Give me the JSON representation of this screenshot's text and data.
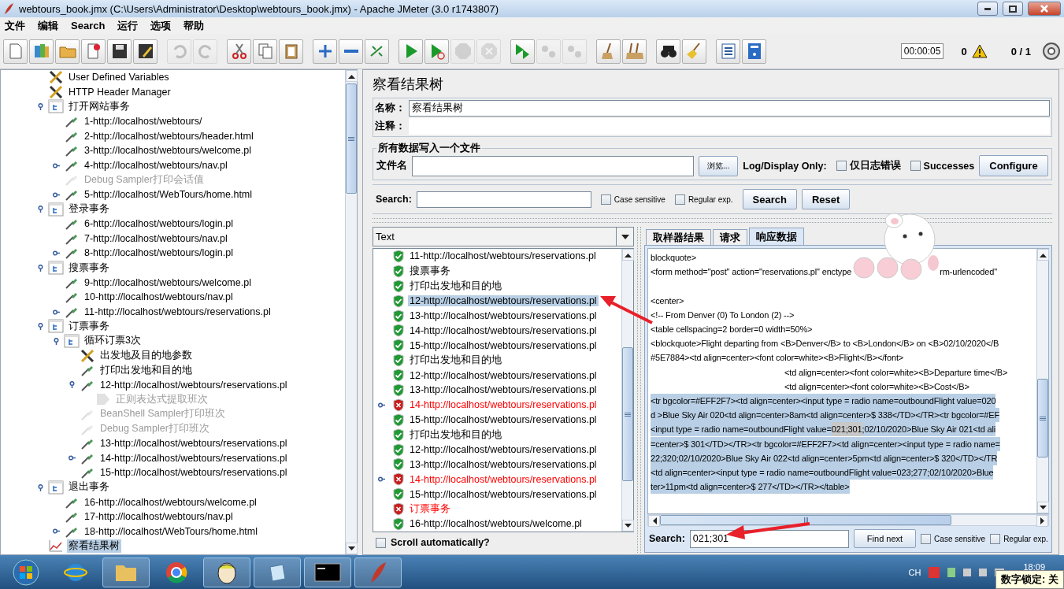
{
  "window": {
    "title": "webtours_book.jmx (C:\\Users\\Administrator\\Desktop\\webtours_book.jmx) - Apache JMeter (3.0 r1743807)"
  },
  "menu": [
    "文件",
    "编辑",
    "Search",
    "运行",
    "选项",
    "帮助"
  ],
  "toolbar": [
    {
      "kind": "new",
      "disabled": false
    },
    {
      "kind": "templates",
      "disabled": false
    },
    {
      "kind": "open",
      "disabled": false
    },
    {
      "kind": "close",
      "disabled": false
    },
    {
      "kind": "save",
      "disabled": false
    },
    {
      "kind": "save_as",
      "disabled": false
    },
    {
      "kind": "sep"
    },
    {
      "kind": "undo",
      "disabled": true
    },
    {
      "kind": "redo",
      "disabled": true
    },
    {
      "kind": "sep"
    },
    {
      "kind": "cut",
      "disabled": false
    },
    {
      "kind": "copy",
      "disabled": false
    },
    {
      "kind": "paste",
      "disabled": false
    },
    {
      "kind": "sep"
    },
    {
      "kind": "expand",
      "disabled": false
    },
    {
      "kind": "collapse",
      "disabled": false
    },
    {
      "kind": "toggle",
      "disabled": false
    },
    {
      "kind": "sep"
    },
    {
      "kind": "start",
      "disabled": false
    },
    {
      "kind": "start_no_pause",
      "disabled": false
    },
    {
      "kind": "stop",
      "disabled": true
    },
    {
      "kind": "shutdown",
      "disabled": true
    },
    {
      "kind": "sep"
    },
    {
      "kind": "remote_start",
      "disabled": false
    },
    {
      "kind": "remote_stop",
      "disabled": true
    },
    {
      "kind": "remote_exit",
      "disabled": true
    },
    {
      "kind": "sep"
    },
    {
      "kind": "clear",
      "disabled": false
    },
    {
      "kind": "clear_all",
      "disabled": false
    },
    {
      "kind": "sep"
    },
    {
      "kind": "search",
      "disabled": false
    },
    {
      "kind": "reset_search",
      "disabled": false
    },
    {
      "kind": "sep"
    },
    {
      "kind": "functions",
      "disabled": false
    },
    {
      "kind": "help",
      "disabled": false
    }
  ],
  "status": {
    "timer": "00:00:05",
    "warnings": "0",
    "threads": "0 / 1"
  },
  "tree": [
    {
      "kind": "config",
      "label": "User Defined Variables",
      "handle": false,
      "disabled": false,
      "selected": false
    },
    {
      "kind": "config",
      "label": "HTTP Header Manager",
      "handle": false,
      "disabled": false,
      "selected": false
    },
    {
      "kind": "controller",
      "label": "打开网站事务",
      "handle": true,
      "expanded": true,
      "disabled": false,
      "selected": false,
      "children": [
        {
          "kind": "sampler",
          "label": "1-http://localhost/webtours/",
          "handle": false,
          "disabled": false,
          "selected": false
        },
        {
          "kind": "sampler",
          "label": "2-http://localhost/webtours/header.html",
          "handle": false,
          "disabled": false,
          "selected": false
        },
        {
          "kind": "sampler",
          "label": "3-http://localhost/webtours/welcome.pl",
          "handle": false,
          "disabled": false,
          "selected": false
        },
        {
          "kind": "sampler",
          "label": "4-http://localhost/webtours/nav.pl",
          "handle": true,
          "expanded": false,
          "disabled": false,
          "selected": false
        },
        {
          "kind": "sampler",
          "label": "Debug Sampler打印会话值",
          "handle": false,
          "disabled": true,
          "selected": false
        },
        {
          "kind": "sampler",
          "label": "5-http://localhost/WebTours/home.html",
          "handle": true,
          "expanded": false,
          "disabled": false,
          "selected": false
        }
      ]
    },
    {
      "kind": "controller",
      "label": "登录事务",
      "handle": true,
      "expanded": true,
      "disabled": false,
      "selected": false,
      "children": [
        {
          "kind": "sampler",
          "label": "6-http://localhost/webtours/login.pl",
          "handle": false,
          "disabled": false,
          "selected": false
        },
        {
          "kind": "sampler",
          "label": "7-http://localhost/webtours/nav.pl",
          "handle": false,
          "disabled": false,
          "selected": false
        },
        {
          "kind": "sampler",
          "label": "8-http://localhost/webtours/login.pl",
          "handle": true,
          "expanded": false,
          "disabled": false,
          "selected": false
        }
      ]
    },
    {
      "kind": "controller",
      "label": "搜票事务",
      "handle": true,
      "expanded": true,
      "disabled": false,
      "selected": false,
      "children": [
        {
          "kind": "sampler",
          "label": "9-http://localhost/webtours/welcome.pl",
          "handle": false,
          "disabled": false,
          "selected": false
        },
        {
          "kind": "sampler",
          "label": "10-http://localhost/webtours/nav.pl",
          "handle": false,
          "disabled": false,
          "selected": false
        },
        {
          "kind": "sampler",
          "label": "11-http://localhost/webtours/reservations.pl",
          "handle": true,
          "expanded": false,
          "disabled": false,
          "selected": false
        }
      ]
    },
    {
      "kind": "controller",
      "label": "订票事务",
      "handle": true,
      "expanded": true,
      "disabled": false,
      "selected": false,
      "children": [
        {
          "kind": "controller",
          "label": "循环订票3次",
          "handle": true,
          "expanded": true,
          "disabled": false,
          "selected": false,
          "children": [
            {
              "kind": "config",
              "label": "出发地及目的地参数",
              "handle": false,
              "disabled": false,
              "selected": false
            },
            {
              "kind": "sampler",
              "label": "打印出发地和目的地",
              "handle": false,
              "disabled": false,
              "selected": false
            },
            {
              "kind": "sampler",
              "label": "12-http://localhost/webtours/reservations.pl",
              "handle": true,
              "expanded": true,
              "disabled": false,
              "selected": false,
              "children": [
                {
                  "kind": "extractor",
                  "label": "正则表达式提取班次",
                  "handle": false,
                  "disabled": true,
                  "selected": false
                }
              ]
            },
            {
              "kind": "sampler",
              "label": "BeanShell Sampler打印班次",
              "handle": false,
              "disabled": true,
              "selected": false
            },
            {
              "kind": "sampler",
              "label": "Debug Sampler打印班次",
              "handle": false,
              "disabled": true,
              "selected": false
            },
            {
              "kind": "sampler",
              "label": "13-http://localhost/webtours/reservations.pl",
              "handle": false,
              "disabled": false,
              "selected": false
            },
            {
              "kind": "sampler",
              "label": "14-http://localhost/webtours/reservations.pl",
              "handle": true,
              "expanded": false,
              "disabled": false,
              "selected": false
            },
            {
              "kind": "sampler",
              "label": "15-http://localhost/webtours/reservations.pl",
              "handle": false,
              "disabled": false,
              "selected": false
            }
          ]
        }
      ]
    },
    {
      "kind": "controller",
      "label": "退出事务",
      "handle": true,
      "expanded": true,
      "disabled": false,
      "selected": false,
      "children": [
        {
          "kind": "sampler",
          "label": "16-http://localhost/webtours/welcome.pl",
          "handle": false,
          "disabled": false,
          "selected": false
        },
        {
          "kind": "sampler",
          "label": "17-http://localhost/webtours/nav.pl",
          "handle": false,
          "disabled": false,
          "selected": false
        },
        {
          "kind": "sampler",
          "label": "18-http://localhost/WebTours/home.html",
          "handle": true,
          "expanded": false,
          "disabled": false,
          "selected": false
        }
      ]
    },
    {
      "kind": "listener",
      "label": "察看结果树",
      "handle": false,
      "disabled": false,
      "selected": true
    }
  ],
  "panel": {
    "title": "察看结果树",
    "name_label": "名称：",
    "name_value": "察看结果树",
    "comment_label": "注释：",
    "file_group": {
      "legend": "所有数据写入一个文件",
      "label": "文件名",
      "browse": "浏览...",
      "log_label": "Log/Display Only:",
      "options": [
        {
          "label": "仅日志错误",
          "checked": false
        },
        {
          "label": "Successes",
          "checked": false
        }
      ],
      "configure": "Configure"
    },
    "search": {
      "label": "Search:",
      "options": [
        {
          "label": "Case sensitive",
          "checked": false
        },
        {
          "label": "Regular exp.",
          "checked": false
        }
      ],
      "buttons": [
        "Search",
        "Reset"
      ]
    },
    "renderer": "Text",
    "results": [
      {
        "label": "11-http://localhost/webtours/reservations.pl",
        "error": false,
        "handle": false,
        "selected": false
      },
      {
        "label": "搜票事务",
        "error": false,
        "handle": false,
        "selected": false
      },
      {
        "label": "打印出发地和目的地",
        "error": false,
        "handle": false,
        "selected": false
      },
      {
        "label": "12-http://localhost/webtours/reservations.pl",
        "error": false,
        "handle": false,
        "selected": true
      },
      {
        "label": "13-http://localhost/webtours/reservations.pl",
        "error": false,
        "handle": false,
        "selected": false
      },
      {
        "label": "14-http://localhost/webtours/reservations.pl",
        "error": false,
        "handle": false,
        "selected": false
      },
      {
        "label": "15-http://localhost/webtours/reservations.pl",
        "error": false,
        "handle": false,
        "selected": false
      },
      {
        "label": "打印出发地和目的地",
        "error": false,
        "handle": false,
        "selected": false
      },
      {
        "label": "12-http://localhost/webtours/reservations.pl",
        "error": false,
        "handle": false,
        "selected": false
      },
      {
        "label": "13-http://localhost/webtours/reservations.pl",
        "error": false,
        "handle": false,
        "selected": false
      },
      {
        "label": "14-http://localhost/webtours/reservations.pl",
        "error": true,
        "handle": true,
        "selected": false
      },
      {
        "label": "15-http://localhost/webtours/reservations.pl",
        "error": false,
        "handle": false,
        "selected": false
      },
      {
        "label": "打印出发地和目的地",
        "error": false,
        "handle": false,
        "selected": false
      },
      {
        "label": "12-http://localhost/webtours/reservations.pl",
        "error": false,
        "handle": false,
        "selected": false
      },
      {
        "label": "13-http://localhost/webtours/reservations.pl",
        "error": false,
        "handle": false,
        "selected": false
      },
      {
        "label": "14-http://localhost/webtours/reservations.pl",
        "error": true,
        "handle": true,
        "selected": false
      },
      {
        "label": "15-http://localhost/webtours/reservations.pl",
        "error": false,
        "handle": false,
        "selected": false
      },
      {
        "label": "订票事务",
        "error": true,
        "handle": false,
        "selected": false
      },
      {
        "label": "16-http://localhost/webtours/welcome.pl",
        "error": false,
        "handle": false,
        "selected": false
      }
    ],
    "scroll_auto": {
      "label": "Scroll automatically?",
      "checked": false
    },
    "tabs": [
      {
        "label": "取样器结果",
        "selected": false
      },
      {
        "label": "请求",
        "selected": false
      },
      {
        "label": "响应数据",
        "selected": true
      }
    ],
    "response": [
      {
        "kind": "text",
        "indented": false,
        "selected": false,
        "parts": [
          {
            "kind": "text",
            "text": "blockquote>",
            "found": false
          }
        ]
      },
      {
        "kind": "text",
        "indented": false,
        "selected": false,
        "parts": [
          {
            "kind": "text",
            "text": "<form method=\"post\" action=\"reservations.pl\" enctype",
            "found": false
          },
          {
            "kind": "covered"
          },
          {
            "kind": "text",
            "text": "rm-urlencoded\"",
            "found": false
          }
        ]
      },
      {
        "kind": "blank"
      },
      {
        "kind": "text",
        "indented": false,
        "selected": false,
        "parts": [
          {
            "kind": "text",
            "text": "<center>",
            "found": false
          }
        ]
      },
      {
        "kind": "text",
        "indented": false,
        "selected": false,
        "parts": [
          {
            "kind": "text",
            "text": "<!-- From Denver (0) To London (2) -->",
            "found": false
          }
        ]
      },
      {
        "kind": "text",
        "indented": false,
        "selected": false,
        "parts": [
          {
            "kind": "text",
            "text": "<table cellspacing=2 border=0 width=50%>",
            "found": false
          }
        ]
      },
      {
        "kind": "text",
        "indented": false,
        "selected": false,
        "parts": [
          {
            "kind": "text",
            "text": "<blockquote>Flight departing from <B>Denver</B> to <B>London</B> on <B>02/10/2020</B",
            "found": false
          }
        ]
      },
      {
        "kind": "text",
        "indented": false,
        "selected": false,
        "parts": [
          {
            "kind": "text",
            "text": "#5E7884><td align=center><font color=white><B>Flight</B></font>",
            "found": false
          }
        ]
      },
      {
        "kind": "text",
        "indented": true,
        "selected": false,
        "parts": [
          {
            "kind": "text",
            "text": "<td align=center><font color=white><B>Departure time</B>",
            "found": false
          }
        ]
      },
      {
        "kind": "text",
        "indented": true,
        "selected": false,
        "parts": [
          {
            "kind": "text",
            "text": "<td align=center><font color=white><B>Cost</B>",
            "found": false
          }
        ]
      },
      {
        "kind": "text",
        "indented": false,
        "selected": true,
        "parts": [
          {
            "kind": "text",
            "text": "<tr bgcolor=#EFF2F7><td align=center><input type = radio name=outboundFlight value=020",
            "found": false
          }
        ]
      },
      {
        "kind": "text",
        "indented": false,
        "selected": true,
        "parts": [
          {
            "kind": "text",
            "text": "d >Blue Sky Air 020<td align=center>8am<td align=center>$ 338</TD></TR><tr bgcolor=#EF",
            "found": false
          }
        ]
      },
      {
        "kind": "text",
        "indented": false,
        "selected": true,
        "parts": [
          {
            "kind": "text",
            "text": "<input type = radio name=outboundFlight value=",
            "found": false
          },
          {
            "kind": "text",
            "text": "021;301",
            "found": true
          },
          {
            "kind": "text",
            "text": ";02/10/2020>Blue Sky Air 021<td ali",
            "found": false
          }
        ]
      },
      {
        "kind": "text",
        "indented": false,
        "selected": true,
        "parts": [
          {
            "kind": "text",
            "text": "=center>$ 301</TD></TR><tr bgcolor=#EFF2F7><td align=center><input type = radio name=",
            "found": false
          }
        ]
      },
      {
        "kind": "text",
        "indented": false,
        "selected": true,
        "parts": [
          {
            "kind": "text",
            "text": "22;320;02/10/2020>Blue Sky Air 022<td align=center>5pm<td align=center>$ 320</TD></TR",
            "found": false
          }
        ]
      },
      {
        "kind": "text",
        "indented": false,
        "selected": true,
        "parts": [
          {
            "kind": "text",
            "text": "<td align=center><input type = radio name=outboundFlight value=023;277;02/10/2020>Blue",
            "found": false
          }
        ]
      },
      {
        "kind": "text",
        "indented": false,
        "selected": true,
        "parts": [
          {
            "kind": "text",
            "text": "ter>11pm<td align=center>$ 277</TD></TR></table>",
            "found": false
          }
        ]
      },
      {
        "kind": "blank"
      }
    ],
    "find": {
      "label": "Search:",
      "value": "021;301",
      "button": "Find next",
      "options": [
        {
          "label": "Case sensitive",
          "checked": false
        },
        {
          "label": "Regular exp.",
          "checked": false
        }
      ]
    }
  },
  "taskbar": {
    "lang": "CH",
    "clock": "18:09",
    "numlock": "数字锁定: 关"
  }
}
